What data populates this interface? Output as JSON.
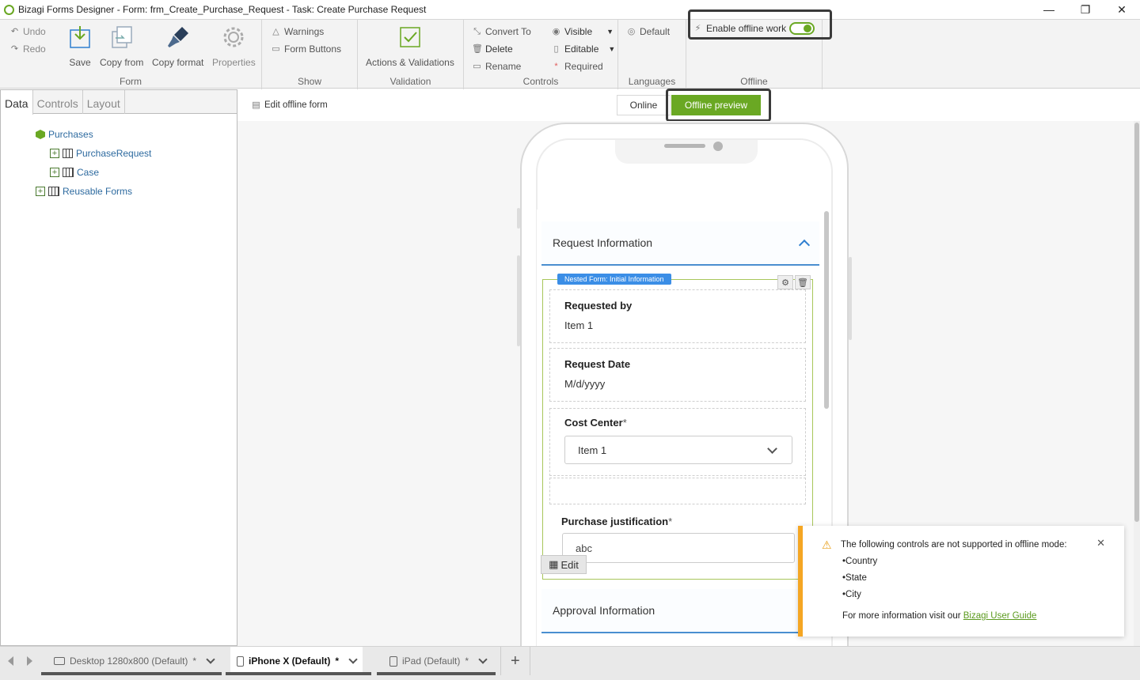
{
  "window": {
    "title": "Bizagi Forms Designer  - Form: frm_Create_Purchase_Request - Task:  Create Purchase Request",
    "minimize": "—",
    "restore": "❐",
    "close": "✕"
  },
  "ribbon": {
    "undo": "Undo",
    "redo": "Redo",
    "save": "Save",
    "copy_from": "Copy from",
    "copy_format": "Copy format",
    "properties": "Properties",
    "form_group": "Form",
    "warnings": "Warnings",
    "form_buttons": "Form Buttons",
    "show_group": "Show",
    "actions_validations": "Actions & Validations",
    "validation_group": "Validation",
    "convert_to": "Convert To",
    "delete": "Delete",
    "rename": "Rename",
    "visible": "Visible",
    "editable": "Editable",
    "required": "Required",
    "controls_group": "Controls",
    "default": "Default",
    "languages_group": "Languages",
    "enable_offline": "Enable offline work",
    "offline_enabled": true,
    "offline_group": "Offline"
  },
  "left_panel": {
    "tabs": [
      "Data",
      "Controls",
      "Layout"
    ],
    "active_tab": "Data",
    "tree": {
      "root": "Purchases",
      "purchase_request": "PurchaseRequest",
      "case": "Case",
      "reusable_forms": "Reusable Forms"
    }
  },
  "canvas": {
    "edit_offline_form": "Edit offline form",
    "online_label": "Online",
    "offline_preview_label": "Offline preview",
    "accent_color": "#6aa823"
  },
  "form": {
    "section1": "Request Information",
    "nested_tag": "Nested Form: Initial Information",
    "requested_by_label": "Requested by",
    "requested_by_value": "Item 1",
    "request_date_label": "Request Date",
    "request_date_value": "M/d/yyyy",
    "cost_center_label": "Cost Center",
    "required_mark": "*",
    "cost_center_value": "Item 1",
    "justification_label": "Purchase justification",
    "justification_value": "abc",
    "edit_label": "Edit",
    "section2": "Approval Information"
  },
  "notification": {
    "message": "The following controls are not supported in offline mode:",
    "items": [
      "•Country",
      "•State",
      "•City"
    ],
    "more_prefix": "For more information visit our",
    "link": "Bizagi User Guide"
  },
  "bottom_tabs": {
    "desktop": "Desktop 1280x800 (Default)",
    "iphone": "iPhone X (Default)",
    "ipad": "iPad (Default)",
    "modified_mark": "*",
    "add": "+"
  }
}
